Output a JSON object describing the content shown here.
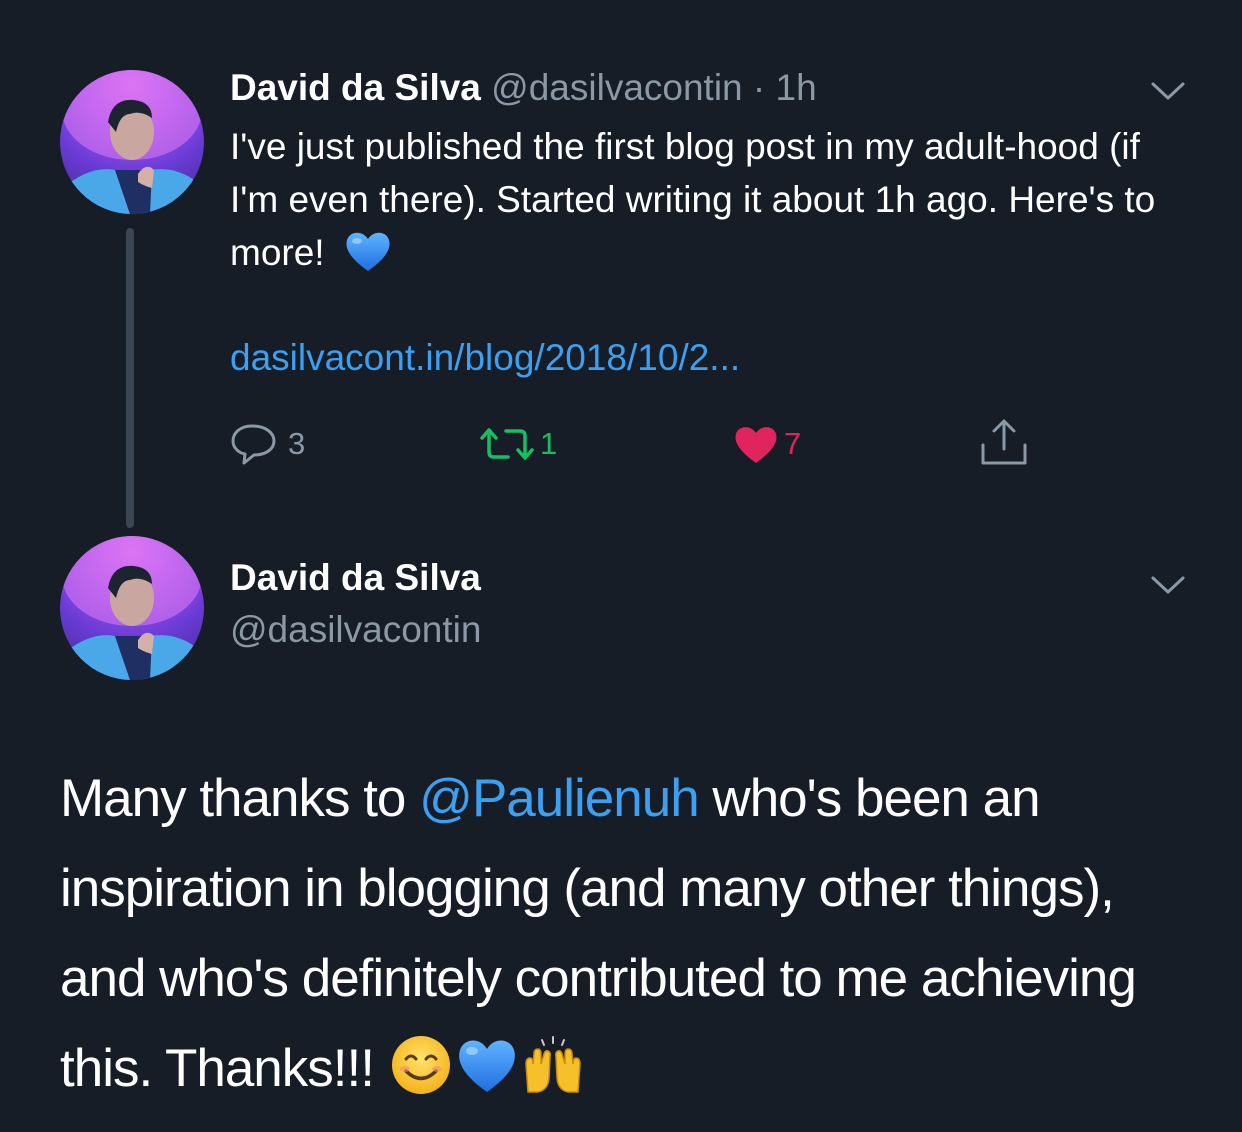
{
  "tweet1": {
    "author_name": "David da Silva",
    "handle": "@dasilvacontin",
    "separator": "·",
    "time": "1h",
    "body": "I've just published the first blog post in my adult-hood (if I'm even there). Started writing it about 1h ago. Here's to more!",
    "body_emoji": "blue-heart-emoji",
    "link": "dasilvacont.in/blog/2018/10/2...",
    "actions": {
      "replies": "3",
      "retweets": "1",
      "likes": "7"
    },
    "colors": {
      "link": "#3ba0f2",
      "retweet": "#17bf63",
      "like": "#e0245e",
      "muted": "#8b98a5"
    }
  },
  "tweet2": {
    "author_name": "David da Silva",
    "handle": "@dasilvacontin",
    "body_before_mention": "Many thanks to ",
    "mention": "@Paulienuh",
    "body_after_mention": " who's been an inspiration in blogging (and many other things), and who's definitely contributed to me achieving this. Thanks!!! ",
    "body_emojis": [
      "smiling-face-emoji",
      "blue-heart-emoji",
      "raising-hands-emoji"
    ]
  },
  "theme": {
    "background": "#161d27",
    "text": "#ffffff"
  }
}
